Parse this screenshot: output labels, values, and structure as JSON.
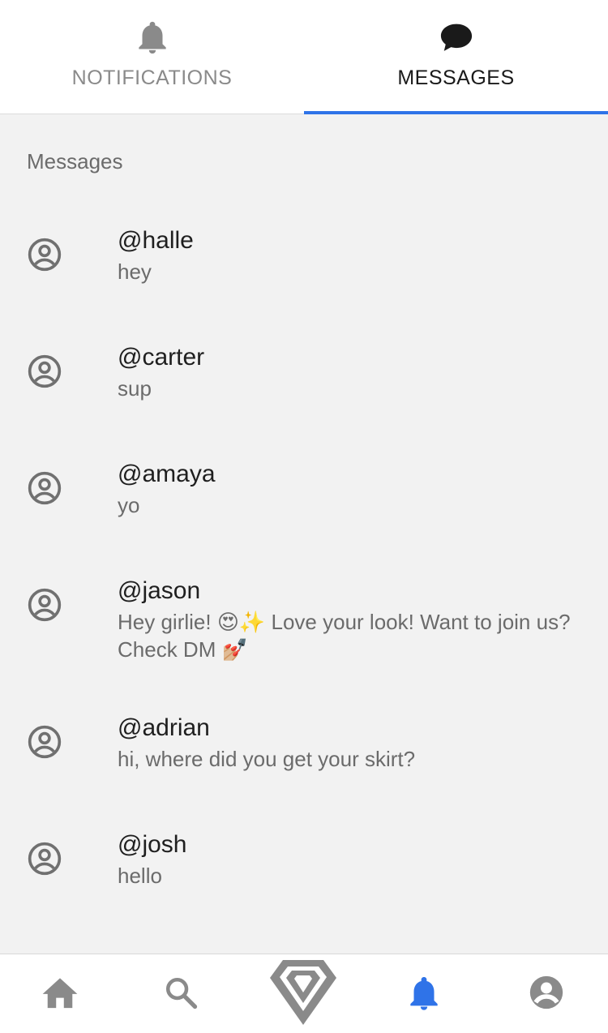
{
  "tabs": {
    "notifications_label": "NOTIFICATIONS",
    "messages_label": "MESSAGES",
    "active": "messages",
    "active_color": "#2f73e8"
  },
  "section": {
    "title": "Messages"
  },
  "messages": [
    {
      "username": "@halle",
      "preview": "hey"
    },
    {
      "username": "@carter",
      "preview": "sup"
    },
    {
      "username": "@amaya",
      "preview": "yo"
    },
    {
      "username": "@jason",
      "preview": "Hey girlie! 😍✨ Love your look! Want to join us? Check DM 💅🏼"
    },
    {
      "username": "@adrian",
      "preview": "hi, where did you get your skirt?"
    },
    {
      "username": "@josh",
      "preview": "hello"
    }
  ],
  "bottom_nav": {
    "items": [
      {
        "icon": "home-icon"
      },
      {
        "icon": "search-icon"
      },
      {
        "icon": "diamond-icon"
      },
      {
        "icon": "bell-icon",
        "active": true
      },
      {
        "icon": "account-icon"
      }
    ],
    "active_color": "#2f73e8",
    "inactive_color": "#8a8a8a"
  }
}
